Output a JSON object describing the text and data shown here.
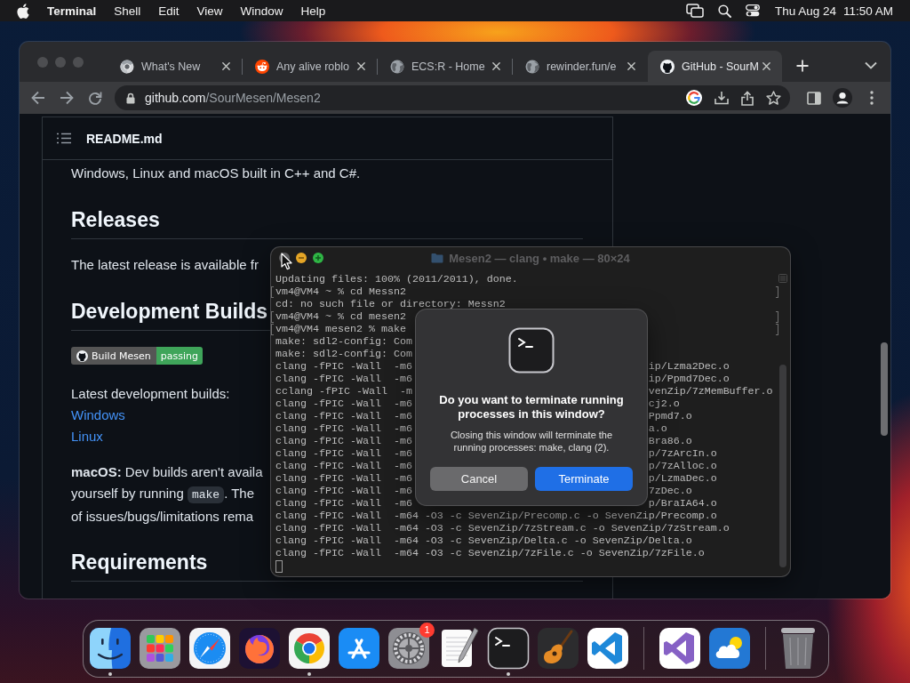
{
  "menu_bar": {
    "app_name": "Terminal",
    "items": [
      "Shell",
      "Edit",
      "View",
      "Window",
      "Help"
    ],
    "date": "Thu Aug 24",
    "time": "11:50 AM"
  },
  "browser": {
    "tabs": [
      {
        "title": "What's New",
        "selected": false
      },
      {
        "title": "Any alive roblo",
        "selected": false
      },
      {
        "title": "ECS:R - Home",
        "selected": false
      },
      {
        "title": "rewinder.fun/e",
        "selected": false
      },
      {
        "title": "GitHub - SourM",
        "selected": true
      }
    ],
    "address_bar": {
      "host": "github.com",
      "path": "/SourMesen/Mesen2"
    },
    "readme": {
      "file_name": "README.md",
      "blocks": [
        {
          "kind": "paragraph",
          "text": "Windows, Linux and macOS built in C++ and C#."
        },
        {
          "kind": "heading",
          "text": "Releases"
        },
        {
          "kind": "paragraph",
          "text": "The latest release is available fr"
        },
        {
          "kind": "heading",
          "text": "Development Builds"
        },
        {
          "kind": "badge",
          "label": "Build Mesen",
          "status": "passing"
        },
        {
          "kind": "links",
          "intro": "Latest development builds:",
          "links": [
            "Windows",
            "Linux"
          ]
        },
        {
          "kind": "lines",
          "lines": [
            [
              {
                "kind": "text",
                "text": "**macOS:** Dev builds aren't availa"
              }
            ],
            [
              {
                "kind": "text",
                "text": "yourself by running "
              },
              {
                "kind": "code",
                "text": "make"
              },
              {
                "kind": "text",
                "text": ". The"
              }
            ],
            [
              {
                "kind": "text",
                "text": "of issues/bugs/limitations rema"
              }
            ]
          ]
        },
        {
          "kind": "heading",
          "text": "Requirements"
        }
      ]
    }
  },
  "terminal": {
    "title": "Mesen2 — clang • make — 80×24",
    "cursor_visible": true,
    "lines": [
      {
        "text": "Updating files: 100% (2011/2011), done.",
        "marked": false
      },
      {
        "text": "vm4@VM4 ~ % cd Messn2",
        "marked": true
      },
      {
        "text": "cd: no such file or directory: Messn2",
        "marked": false
      },
      {
        "text": "vm4@VM4 ~ % cd mesen2",
        "marked": true
      },
      {
        "text": "vm4@VM4 mesen2 % make",
        "marked": true
      },
      {
        "text": "make: sdl2-config: Com",
        "marked": false
      },
      {
        "text": "make: sdl2-config: Com",
        "marked": false
      },
      {
        "left": "clang -fPIC -Wall  -m6",
        "right": "ip/Lzma2Dec.o",
        "marked": false
      },
      {
        "left": "clang -fPIC -Wall  -m6",
        "right": "ip/Ppmd7Dec.o",
        "marked": false
      },
      {
        "left": "cclang -fPIC -Wall  -m",
        "right": "venZip/7zMemBuffer.o",
        "marked": false
      },
      {
        "left": "clang -fPIC -Wall  -m6",
        "right": "cj2.o",
        "marked": false
      },
      {
        "left": "clang -fPIC -Wall  -m6",
        "right": "Ppmd7.o",
        "marked": false
      },
      {
        "left": "clang -fPIC -Wall  -m6",
        "right": "a.o",
        "marked": false
      },
      {
        "left": "clang -fPIC -Wall  -m6",
        "right": "Bra86.o",
        "marked": false
      },
      {
        "left": "clang -fPIC -Wall  -m6",
        "right": "p/7zArcIn.o",
        "marked": false
      },
      {
        "left": "clang -fPIC -Wall  -m6",
        "right": "p/7zAlloc.o",
        "marked": false
      },
      {
        "left": "clang -fPIC -Wall  -m6",
        "right": "p/LzmaDec.o",
        "marked": false
      },
      {
        "left": "clang -fPIC -Wall  -m6",
        "right": "7zDec.o",
        "marked": false
      },
      {
        "left": "clang -fPIC -Wall  -m6",
        "right": "p/BraIA64.o",
        "marked": false
      },
      {
        "text": "clang -fPIC -Wall  -m64 -O3 -c SevenZip/Precomp.c -o SevenZip/Precomp.o",
        "marked": false
      },
      {
        "text": "clang -fPIC -Wall  -m64 -O3 -c SevenZip/7zStream.c -o SevenZip/7zStream.o",
        "marked": false
      },
      {
        "text": "clang -fPIC -Wall  -m64 -O3 -c SevenZip/Delta.c -o SevenZip/Delta.o",
        "marked": false
      },
      {
        "text": "clang -fPIC -Wall  -m64 -O3 -c SevenZip/7zFile.c -o SevenZip/7zFile.o",
        "marked": false
      }
    ]
  },
  "dialog": {
    "title": "Do you want to terminate running processes in this window?",
    "message": "Closing this window will terminate the running processes: make, clang (2).",
    "buttons": [
      {
        "label": "Cancel",
        "default": false
      },
      {
        "label": "Terminate",
        "default": true
      }
    ]
  },
  "dock": {
    "groups": [
      [
        {
          "running": true
        },
        {
          "running": false
        },
        {
          "running": false
        },
        {
          "running": false
        },
        {
          "running": true
        },
        {
          "running": false
        },
        {
          "running": false,
          "badge": "1"
        },
        {
          "running": false
        },
        {
          "running": true
        },
        {
          "running": false
        },
        {
          "running": false
        }
      ],
      [
        {
          "running": false
        },
        {
          "running": false
        }
      ],
      [
        {
          "running": false
        }
      ]
    ]
  }
}
